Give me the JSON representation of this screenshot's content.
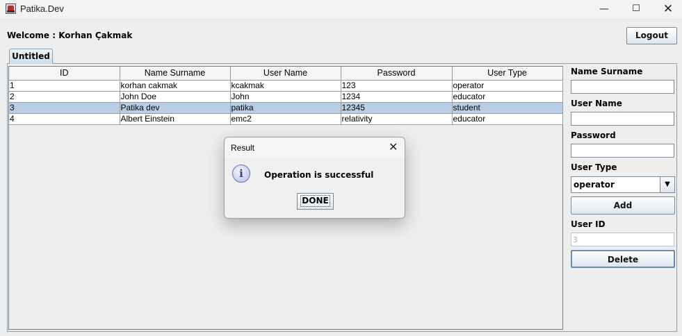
{
  "window": {
    "title": "Patika.Dev",
    "minimize_glyph": "—",
    "maximize_glyph": "☐",
    "close_glyph": "✕"
  },
  "header": {
    "welcome": "Welcome : Korhan Çakmak",
    "logout_label": "Logout"
  },
  "tabs": [
    "Untitled"
  ],
  "table": {
    "columns": [
      "ID",
      "Name Surname",
      "User Name",
      "Password",
      "User Type"
    ],
    "rows": [
      [
        "1",
        "korhan cakmak",
        "kcakmak",
        "123",
        "operator"
      ],
      [
        "2",
        "John Doe",
        "John",
        "1234",
        "educator"
      ],
      [
        "3",
        "Patika dev",
        "patika",
        "12345",
        "student"
      ],
      [
        "4",
        "Albert Einstein",
        "emc2",
        "relativity",
        "educator"
      ]
    ],
    "selected_row": 2
  },
  "form": {
    "name_label": "Name Surname",
    "name_value": "",
    "username_label": "User Name",
    "username_value": "",
    "password_label": "Password",
    "password_value": "",
    "usertype_label": "User Type",
    "usertype_value": "operator",
    "add_label": "Add",
    "userid_label": "User ID",
    "userid_value": "3",
    "delete_label": "Delete"
  },
  "dialog": {
    "title": "Result",
    "close_glyph": "✕",
    "icon": "information-icon",
    "icon_glyph": "i",
    "message": "Operation is successful",
    "button_label": "DONE"
  }
}
